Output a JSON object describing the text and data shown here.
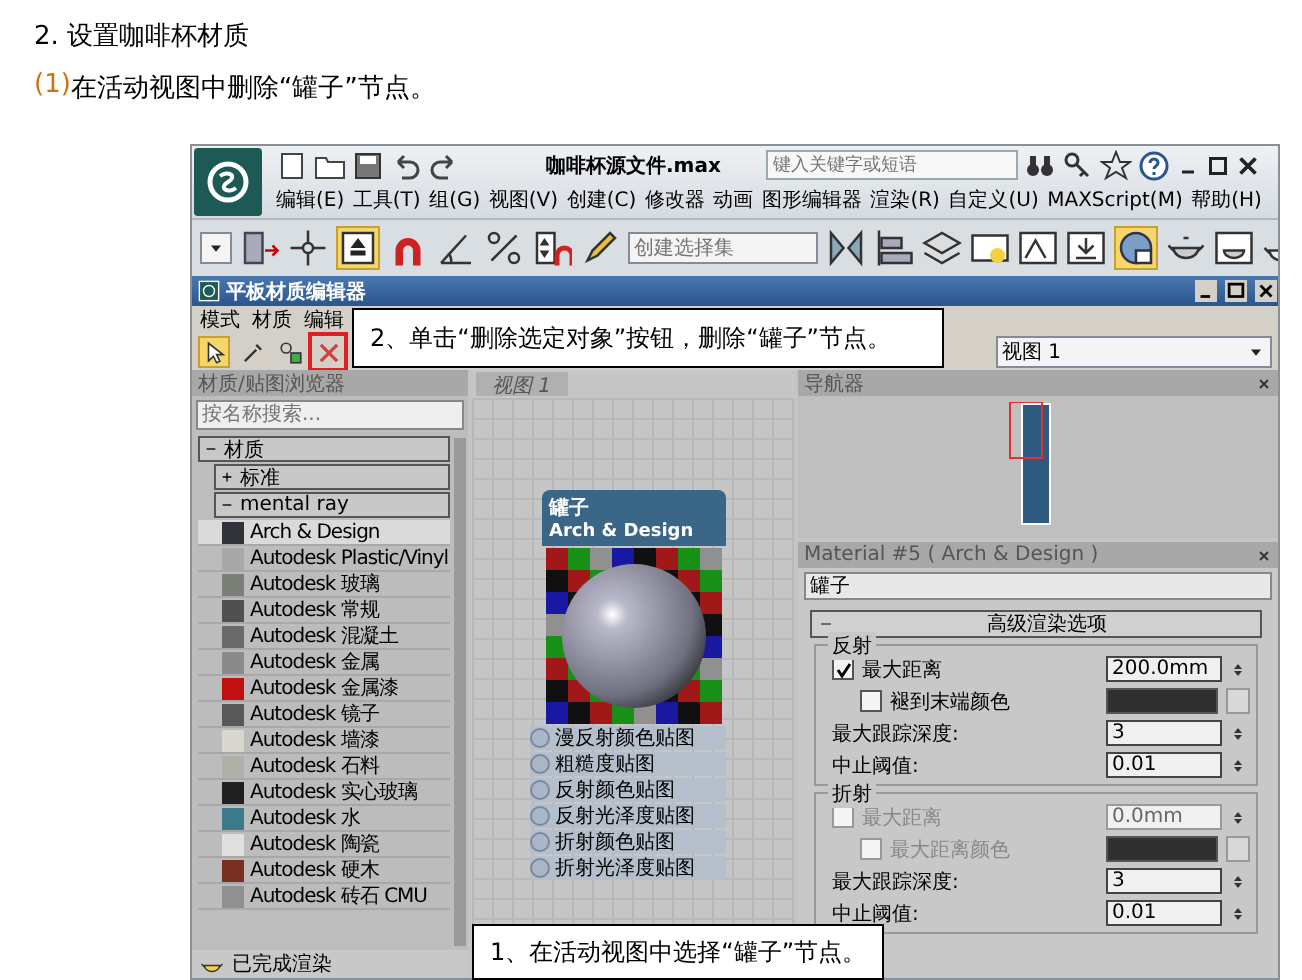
{
  "heading": "2. 设置咖啡杯材质",
  "step": {
    "number": "(1)",
    "text": "在活动视图中删除“罐子”节点。"
  },
  "max_window": {
    "title": "咖啡杯源文件.max",
    "search": {
      "placeholder": "键入关键字或短语"
    },
    "menu": [
      "编辑(E)",
      "工具(T)",
      "组(G)",
      "视图(V)",
      "创建(C)",
      "修改器",
      "动画",
      "图形编辑器",
      "渲染(R)",
      "自定义(U)",
      "MAXScript(M)",
      "帮助(H)"
    ],
    "selection_set": {
      "placeholder": "创建选择集"
    }
  },
  "editor": {
    "title": "平板材质编辑器",
    "menu": [
      "模式",
      "材质",
      "编辑"
    ],
    "view_select": "视图 1",
    "tools": [
      {
        "kind": "select",
        "selected": true
      },
      {
        "kind": "eyedropper",
        "selected": false
      },
      {
        "kind": "scene",
        "selected": false
      },
      {
        "kind": "delete",
        "selected": false
      }
    ],
    "browser": {
      "title": "材质/贴图浏览器",
      "search": {
        "placeholder": "按名称搜索..."
      },
      "groups": [
        {
          "label": "材质",
          "expanded": true,
          "children": [
            {
              "label": "标准",
              "expanded": false
            },
            {
              "label": "mental ray",
              "expanded": true,
              "children": [
                {
                  "label": "Arch & Design",
                  "color": "#303438",
                  "selected": true
                },
                {
                  "label": "Autodesk Plastic/Vinyl",
                  "color": "#a8a8a8",
                  "selected": false
                },
                {
                  "label": "Autodesk 玻璃",
                  "color": "#7a8078",
                  "selected": false
                },
                {
                  "label": "Autodesk 常规",
                  "color": "#505050",
                  "selected": false
                },
                {
                  "label": "Autodesk 混凝土",
                  "color": "#6a6a6a",
                  "selected": false
                },
                {
                  "label": "Autodesk 金属",
                  "color": "#8a8a8a",
                  "selected": false
                },
                {
                  "label": "Autodesk 金属漆",
                  "color": "#c01010",
                  "selected": false
                },
                {
                  "label": "Autodesk 镜子",
                  "color": "#585858",
                  "selected": false
                },
                {
                  "label": "Autodesk 墙漆",
                  "color": "#d8d8d0",
                  "selected": false
                },
                {
                  "label": "Autodesk 石料",
                  "color": "#b0b0a8",
                  "selected": false
                },
                {
                  "label": "Autodesk 实心玻璃",
                  "color": "#202020",
                  "selected": false
                },
                {
                  "label": "Autodesk 水",
                  "color": "#3a7a8a",
                  "selected": false
                },
                {
                  "label": "Autodesk 陶瓷",
                  "color": "#e0e0e0",
                  "selected": false
                },
                {
                  "label": "Autodesk 硬木",
                  "color": "#7a3020",
                  "selected": false
                },
                {
                  "label": "Autodesk 砖石 CMU",
                  "color": "#909090",
                  "selected": false
                }
              ]
            }
          ]
        }
      ]
    },
    "status": "已完成渲染",
    "view_tab": "视图 1",
    "node": {
      "title": "罐子",
      "subtitle": "Arch & Design",
      "slots": [
        "漫反射颜色贴图",
        "粗糙度贴图",
        "反射颜色贴图",
        "反射光泽度贴图",
        "折射颜色贴图",
        "折射光泽度贴图"
      ]
    },
    "navigator": {
      "title": "导航器"
    },
    "params": {
      "title": "Material #5  ( Arch & Design )",
      "name": "罐子",
      "rollout": "高级渲染选项",
      "groups": [
        {
          "title": "反射",
          "rows": [
            {
              "kind": "check",
              "label": "最大距离",
              "checked": true,
              "disabled": false,
              "value": "200.0mm"
            },
            {
              "kind": "colorcheck",
              "label": "褪到末端颜色",
              "checked": false,
              "disabled": false,
              "color": "#303030"
            },
            {
              "kind": "spinner",
              "label": "最大跟踪深度:",
              "value": "3"
            },
            {
              "kind": "spinner",
              "label": "中止阈值:",
              "value": "0.01"
            }
          ]
        },
        {
          "title": "折射",
          "rows": [
            {
              "kind": "check",
              "label": "最大距离",
              "checked": false,
              "disabled": true,
              "value": "0.0mm"
            },
            {
              "kind": "colorcheck",
              "label": "最大距离颜色",
              "checked": false,
              "disabled": true,
              "color": "#303030"
            },
            {
              "kind": "spinner",
              "label": "最大跟踪深度:",
              "value": "3"
            },
            {
              "kind": "spinner",
              "label": "中止阈值:",
              "value": "0.01"
            }
          ]
        }
      ]
    }
  },
  "callouts": [
    "2、单击“删除选定对象”按钮，删除“罐子”节点。",
    "1、在活动视图中选择“罐子”节点。"
  ]
}
